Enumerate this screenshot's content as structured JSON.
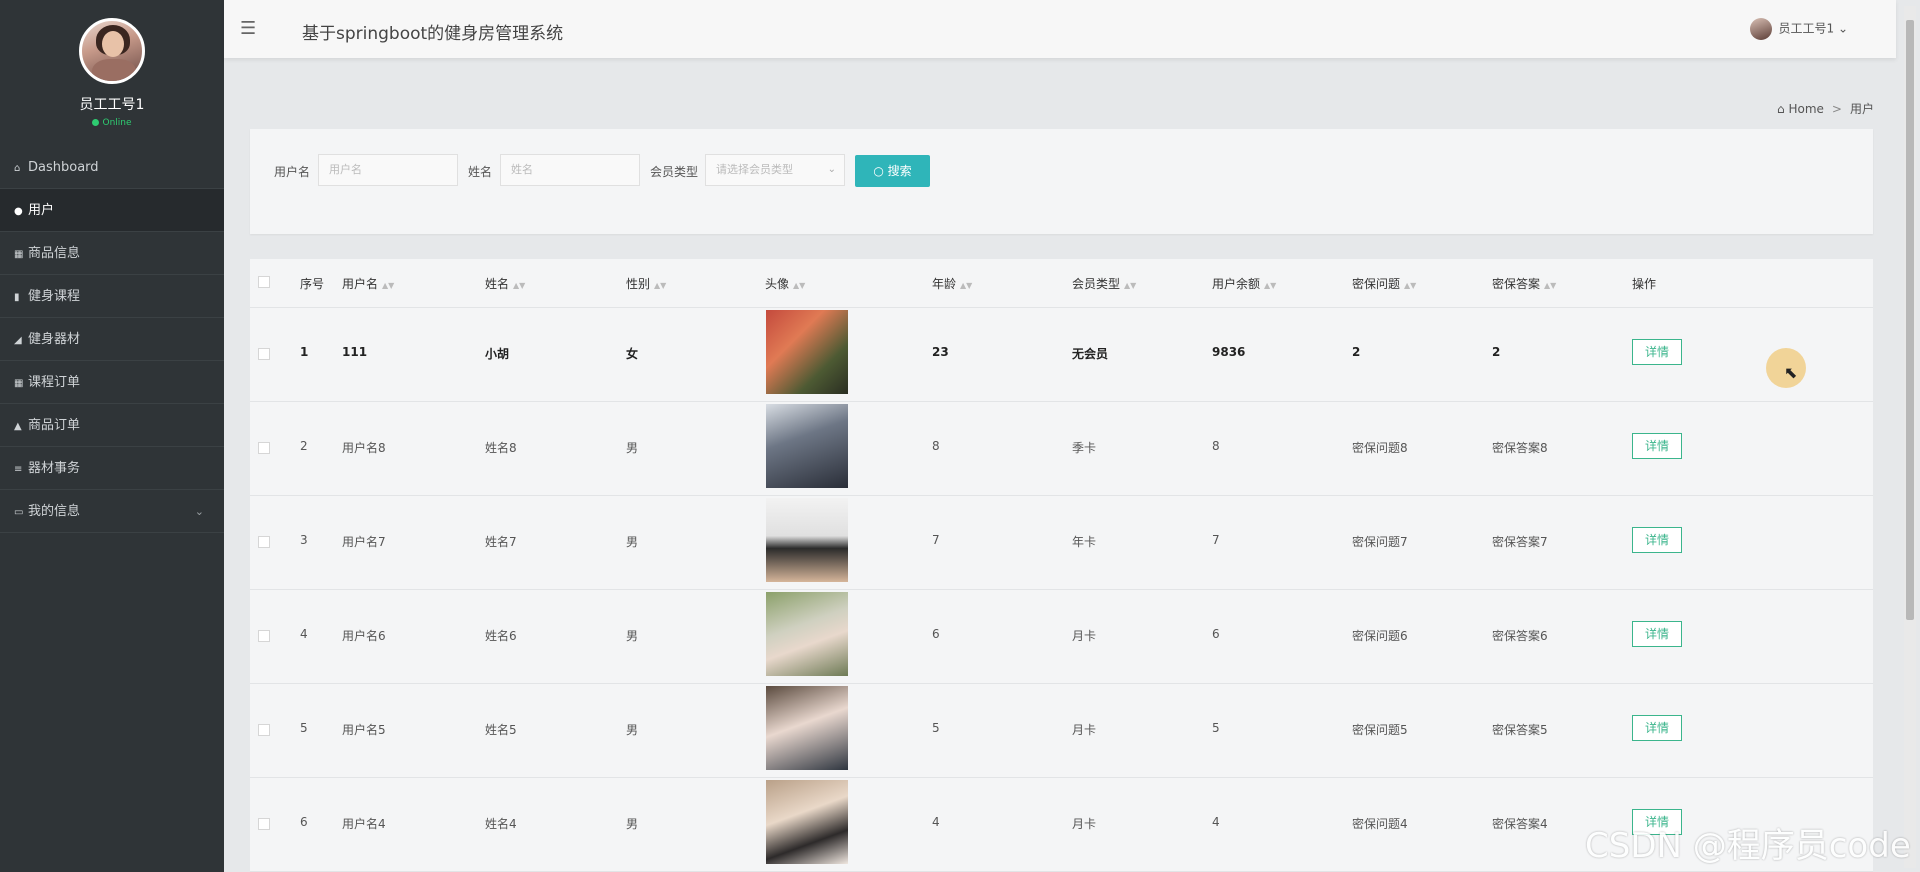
{
  "sidebar": {
    "user_name": "员工工号1",
    "status": "Online",
    "items": [
      {
        "icon": "home-icon",
        "glyph": "⌂",
        "label": "Dashboard"
      },
      {
        "icon": "user-icon",
        "glyph": "●",
        "label": "用户"
      },
      {
        "icon": "grid-icon",
        "glyph": "▦",
        "label": "商品信息"
      },
      {
        "icon": "book-icon",
        "glyph": "▮",
        "label": "健身课程"
      },
      {
        "icon": "dumbbell-icon",
        "glyph": "◢",
        "label": "健身器材"
      },
      {
        "icon": "grid-icon",
        "glyph": "▦",
        "label": "课程订单"
      },
      {
        "icon": "bag-icon",
        "glyph": "▲",
        "label": "商品订单"
      },
      {
        "icon": "list-icon",
        "glyph": "≡",
        "label": "器材事务"
      },
      {
        "icon": "card-icon",
        "glyph": "▭",
        "label": "我的信息"
      }
    ]
  },
  "header": {
    "title": "基于springboot的健身房管理系统",
    "user": "员工工号1"
  },
  "breadcrumb": {
    "home": "Home",
    "current": "用户"
  },
  "search": {
    "username_label": "用户名",
    "username_placeholder": "用户名",
    "name_label": "姓名",
    "name_placeholder": "姓名",
    "type_label": "会员类型",
    "type_placeholder": "请选择会员类型",
    "button": "搜索"
  },
  "table": {
    "columns": [
      "序号",
      "用户名",
      "姓名",
      "性别",
      "头像",
      "年龄",
      "会员类型",
      "用户余额",
      "密保问题",
      "密保答案",
      "操作"
    ],
    "rows": [
      [
        "1",
        "111",
        "小胡",
        "女",
        "23",
        "无会员",
        "9836",
        "2",
        "2"
      ],
      [
        "2",
        "用户名8",
        "姓名8",
        "男",
        "8",
        "季卡",
        "8",
        "密保问题8",
        "密保答案8"
      ],
      [
        "3",
        "用户名7",
        "姓名7",
        "男",
        "7",
        "年卡",
        "7",
        "密保问题7",
        "密保答案7"
      ],
      [
        "4",
        "用户名6",
        "姓名6",
        "男",
        "6",
        "月卡",
        "6",
        "密保问题6",
        "密保答案6"
      ],
      [
        "5",
        "用户名5",
        "姓名5",
        "男",
        "5",
        "月卡",
        "5",
        "密保问题5",
        "密保答案5"
      ],
      [
        "6",
        "用户名4",
        "姓名4",
        "男",
        "4",
        "月卡",
        "4",
        "密保问题4",
        "密保答案4"
      ]
    ],
    "detail_label": "详情"
  },
  "watermark": "CSDN @程序员code",
  "colors": {
    "sidebar": "#2f3437",
    "accent": "#2fb5b9",
    "detail": "#3bb58c"
  }
}
